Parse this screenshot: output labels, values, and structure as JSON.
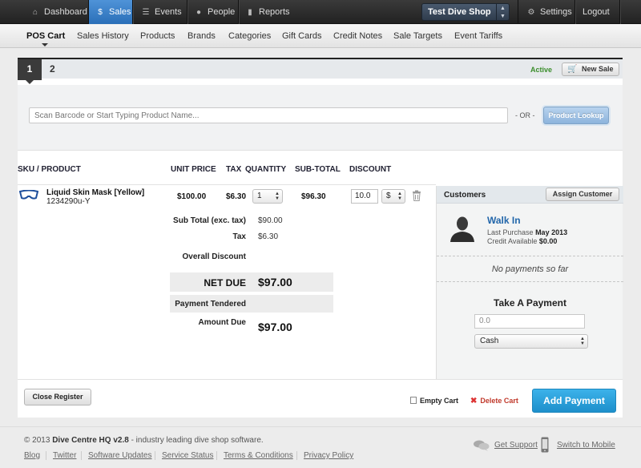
{
  "topnav": {
    "items": [
      {
        "label": "Dashboard",
        "icon": "home-icon"
      },
      {
        "label": "Sales",
        "icon": "dollar-icon"
      },
      {
        "label": "Events",
        "icon": "list-icon"
      },
      {
        "label": "People",
        "icon": "person-icon"
      },
      {
        "label": "Reports",
        "icon": "bar-chart-icon"
      }
    ],
    "store": "Test Dive Shop",
    "settings_label": "Settings",
    "logout_label": "Logout",
    "active_color": "#3a82cc"
  },
  "subnav": {
    "items": [
      "POS Cart",
      "Sales History",
      "Products",
      "Brands",
      "Categories",
      "Gift Cards",
      "Credit Notes",
      "Sale Targets",
      "Event Tariffs"
    ]
  },
  "cart": {
    "tabs": [
      "1",
      "2"
    ],
    "status": "Active",
    "new_sale_label": "New Sale",
    "scan_placeholder": "Scan Barcode or Start Typing Product Name...",
    "or_text": "- OR -",
    "lookup_label": "Product Lookup",
    "columns": [
      "SKU / PRODUCT",
      "UNIT PRICE",
      "TAX",
      "QUANTITY",
      "SUB-TOTAL",
      "DISCOUNT"
    ],
    "item": {
      "name": "Liquid Skin Mask [Yellow]",
      "sku": "1234290u-Y",
      "unit_price": "$100.00",
      "tax": "$6.30",
      "quantity": "1",
      "subtotal": "$96.30",
      "discount": "10.0",
      "discount_type": "$"
    },
    "summary": {
      "subtotal_label": "Sub Total (exc. tax)",
      "subtotal_value": "$90.00",
      "tax_label": "Tax",
      "tax_value": "$6.30",
      "overall_discount_label": "Overall Discount",
      "net_due_label": "NET DUE",
      "net_due_value": "$97.00",
      "tendered_label": "Payment Tendered",
      "amount_due_label": "Amount Due",
      "amount_due_value": "$97.00"
    }
  },
  "customer": {
    "title": "Customers",
    "assign_label": "Assign Customer",
    "name": "Walk In",
    "last_purchase_label": "Last Purchase",
    "last_purchase_value": "May 2013",
    "credit_label": "Credit Available",
    "credit_value": "$0.00",
    "no_payments": "No payments so far",
    "take_payment": "Take A Payment",
    "amount_placeholder": "0.0",
    "method": "Cash"
  },
  "actions": {
    "close_register": "Close Register",
    "empty_cart": "Empty Cart",
    "delete_cart": "Delete Cart",
    "add_payment": "Add Payment"
  },
  "footer": {
    "copyright_prefix": "© 2013",
    "brand": "Dive Centre HQ v2.8",
    "tagline": "- industry leading dive shop software.",
    "links": [
      "Blog",
      "Twitter",
      "Software Updates",
      "Service Status",
      "Terms & Conditions",
      "Privacy Policy"
    ],
    "support": "Get Support",
    "mobile": "Switch to Mobile"
  }
}
